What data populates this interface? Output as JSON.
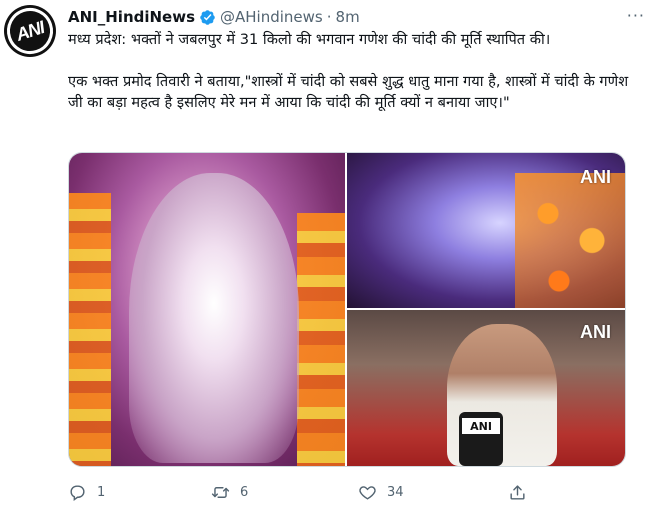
{
  "tweet": {
    "author_name": "ANI_HindiNews",
    "handle": "@AHindinews",
    "separator": "·",
    "time": "8m",
    "more": "···",
    "line1": "मध्य प्रदेश: भक्तों ने जबलपुर में 31 किलो की भगवान गणेश की चांदी की मूर्ति स्थापित की।",
    "line2": "एक भक्त प्रमोद तिवारी ने बताया,\"शास्त्रों में चांदी को सबसे शुद्ध धातु माना गया है, शास्त्रों में चांदी के गणेश जी का बड़ा महत्व है इसलिए मेरे मन में आया कि चांदी की मूर्ति क्यों न बनाया जाए।\""
  },
  "avatar": {
    "logo_text": "ANI"
  },
  "media": {
    "watermark_top_right": "ANI",
    "watermark_bottom_right": "ANI",
    "mic_label": "ANI"
  },
  "actions": {
    "reply_count": "1",
    "retweet_count": "6",
    "like_count": "34",
    "reply_icon": "reply-icon",
    "retweet_icon": "retweet-icon",
    "like_icon": "heart-icon",
    "share_icon": "share-icon"
  },
  "colors": {
    "verified": "#1d9bf0",
    "text": "#0f1419",
    "muted": "#536471",
    "border": "#cfd9de"
  }
}
